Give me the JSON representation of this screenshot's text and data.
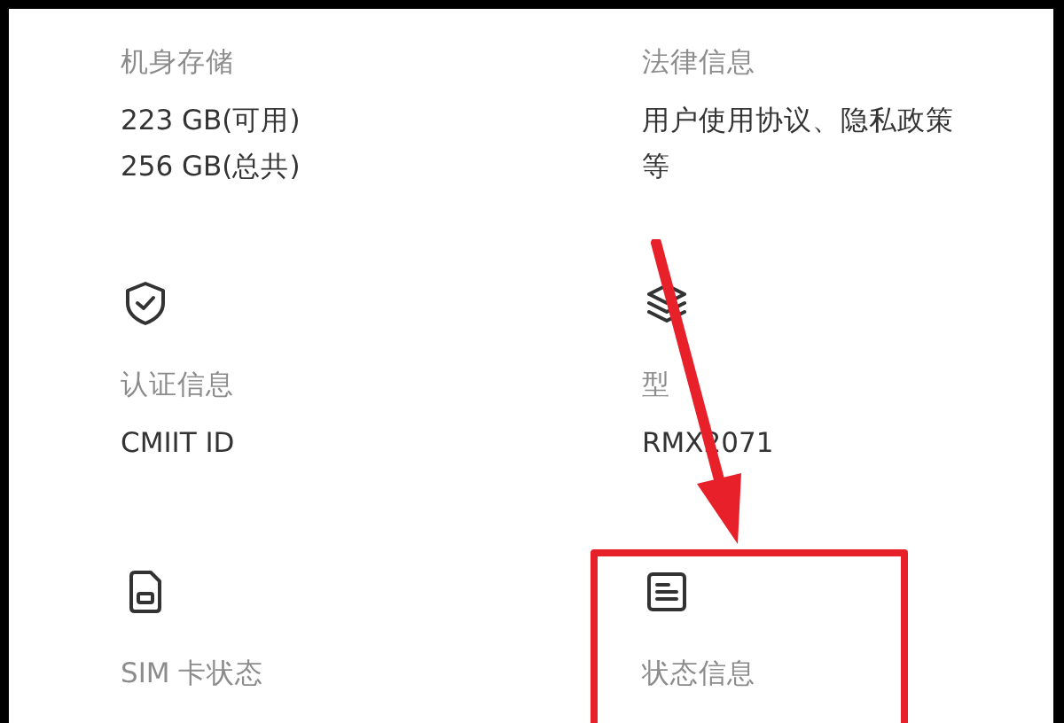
{
  "tiles": [
    {
      "kind": "storage",
      "label": "机身存储",
      "values": [
        "223 GB(可用)",
        "256 GB(总共)"
      ],
      "highlighted": false
    },
    {
      "kind": "legal",
      "label": "法律信息",
      "values": [
        "用户使用协议、隐私政策等"
      ],
      "highlighted": false
    },
    {
      "kind": "certification",
      "label": "认证信息",
      "values": [
        "CMIIT ID"
      ],
      "highlighted": false
    },
    {
      "kind": "model",
      "label": "型",
      "values": [
        "RMX2071"
      ],
      "highlighted": false
    },
    {
      "kind": "sim",
      "label": "SIM 卡状态",
      "highlighted": false
    },
    {
      "kind": "status",
      "label": "状态信息",
      "highlighted": true
    }
  ]
}
